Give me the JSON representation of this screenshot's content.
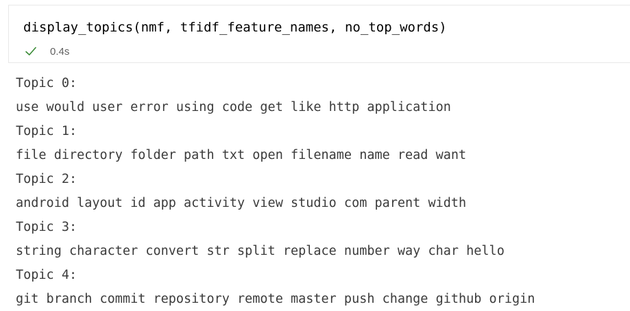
{
  "cell": {
    "code": "display_topics(nmf, tfidf_feature_names, no_top_words)",
    "status_icon": "check-icon",
    "status_color": "#388a34",
    "exec_time": "0.4s"
  },
  "output": {
    "lines": [
      "Topic 0:",
      "use would user error using code get like http application",
      "Topic 1:",
      "file directory folder path txt open filename name read want",
      "Topic 2:",
      "android layout id app activity view studio com parent width",
      "Topic 3:",
      "string character convert str split replace number way char hello",
      "Topic 4:",
      "git branch commit repository remote master push change github origin"
    ]
  }
}
